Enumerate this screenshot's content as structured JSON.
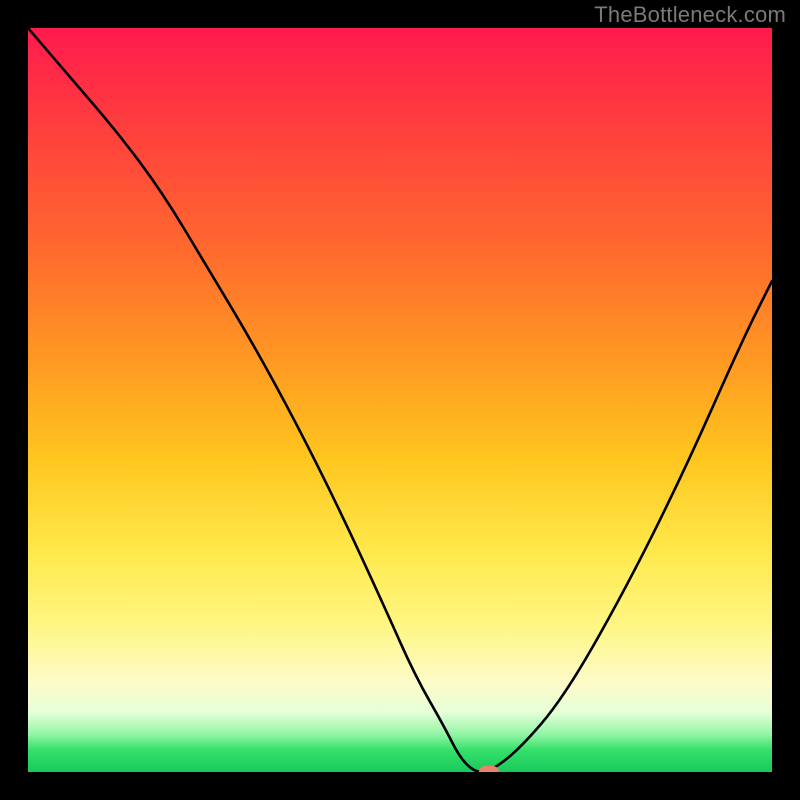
{
  "watermark": "TheBottleneck.com",
  "chart_data": {
    "type": "line",
    "title": "",
    "xlabel": "",
    "ylabel": "",
    "xlim": [
      0,
      100
    ],
    "ylim": [
      0,
      100
    ],
    "grid": false,
    "legend": false,
    "series": [
      {
        "name": "bottleneck-curve",
        "x": [
          0,
          6,
          12,
          18,
          24,
          30,
          36,
          42,
          48,
          52,
          56,
          58,
          60,
          62,
          66,
          72,
          80,
          88,
          96,
          100
        ],
        "y": [
          100,
          93,
          86,
          78,
          68,
          58,
          47,
          35,
          22,
          13,
          6,
          2,
          0,
          0,
          3,
          10,
          24,
          40,
          58,
          66
        ]
      }
    ],
    "annotations": [
      {
        "name": "optimal-marker",
        "x": 62,
        "y": 0,
        "color": "#e9836d"
      }
    ],
    "background": {
      "type": "vertical-gradient",
      "stops": [
        {
          "pos": 0.0,
          "color": "#ff1a4d"
        },
        {
          "pos": 0.12,
          "color": "#ff3b3f"
        },
        {
          "pos": 0.3,
          "color": "#ff6a2e"
        },
        {
          "pos": 0.45,
          "color": "#ff9a22"
        },
        {
          "pos": 0.58,
          "color": "#ffc61f"
        },
        {
          "pos": 0.7,
          "color": "#ffe84a"
        },
        {
          "pos": 0.8,
          "color": "#fff682"
        },
        {
          "pos": 0.88,
          "color": "#fdfbc9"
        },
        {
          "pos": 0.92,
          "color": "#e6ffd8"
        },
        {
          "pos": 0.95,
          "color": "#8ff5a3"
        },
        {
          "pos": 0.97,
          "color": "#37e06b"
        },
        {
          "pos": 1.0,
          "color": "#18c95b"
        }
      ]
    }
  }
}
